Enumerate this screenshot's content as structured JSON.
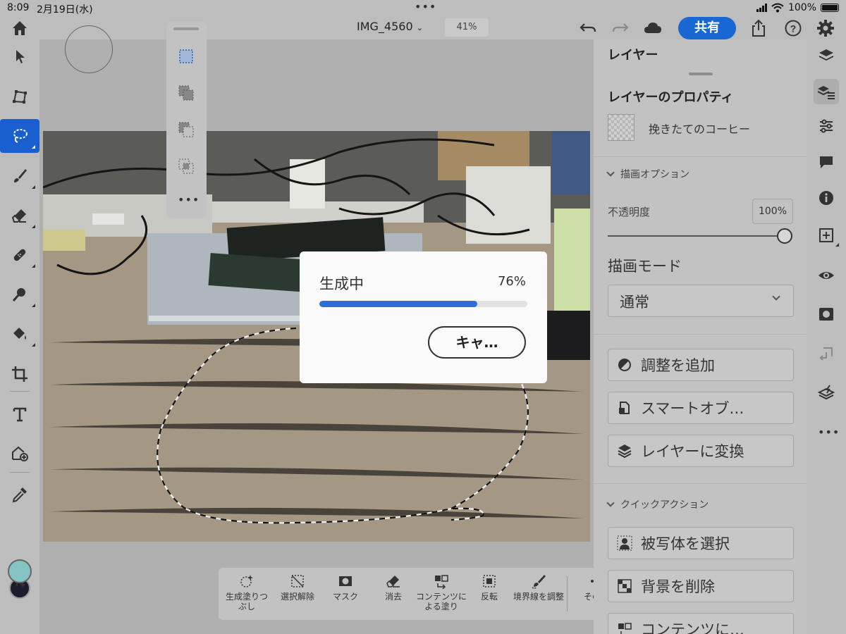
{
  "status_bar": {
    "time": "8:09",
    "date": "2月19日(水)",
    "battery": "100%"
  },
  "topbar": {
    "document_title": "IMG_4560",
    "zoom": "41%",
    "share_label": "共有"
  },
  "left_tools": [
    {
      "name": "select-tool",
      "icon": "arrow-icon"
    },
    {
      "name": "transform-tool",
      "icon": "transform-icon"
    },
    {
      "name": "lasso-tool",
      "icon": "lasso-icon",
      "active": true
    },
    {
      "name": "brush-tool",
      "icon": "brush-icon"
    },
    {
      "name": "eraser-tool",
      "icon": "eraser-icon"
    },
    {
      "name": "heal-tool",
      "icon": "bandage-icon"
    },
    {
      "name": "dodge-burn-tool",
      "icon": "dodge-icon"
    },
    {
      "name": "fill-tool",
      "icon": "paint-bucket-icon"
    },
    {
      "name": "crop-tool",
      "icon": "crop-icon"
    },
    {
      "name": "type-tool",
      "icon": "text-icon"
    },
    {
      "name": "place-image-tool",
      "icon": "place-image-icon"
    },
    {
      "name": "eyedropper-tool",
      "icon": "eyedropper-icon"
    }
  ],
  "colors": {
    "foreground": "#86c3c4",
    "background": "#1c1c2c",
    "accent": "#1967d2"
  },
  "progress_dialog": {
    "label": "生成中",
    "percent_text": "76%",
    "progress": 0.76,
    "cancel_label": "キャ…"
  },
  "context_bar": {
    "items": [
      {
        "label": "生成塗りつぶし",
        "icon": "generative-fill-icon"
      },
      {
        "label": "選択解除",
        "icon": "deselect-icon"
      },
      {
        "label": "マスク",
        "icon": "mask-icon"
      },
      {
        "label": "消去",
        "icon": "eraser-icon"
      },
      {
        "label": "コンテンツによる塗り",
        "icon": "content-aware-fill-icon"
      },
      {
        "label": "反転",
        "icon": "invert-icon"
      },
      {
        "label": "境界線を調整",
        "icon": "refine-edge-icon"
      },
      {
        "label": "その他",
        "icon": "more-icon"
      }
    ]
  },
  "panel": {
    "header": "レイヤー",
    "properties_title": "レイヤーのプロパティ",
    "layer_name": "挽きたてのコーヒー",
    "draw_options_title": "描画オプション",
    "opacity_label": "不透明度",
    "opacity_value": "100%",
    "opacity": 1.0,
    "blend_mode_label": "描画モード",
    "blend_mode_value": "通常",
    "actions": [
      {
        "label": "調整を追加",
        "icon": "adjustment-icon"
      },
      {
        "label": "スマートオブ…",
        "icon": "smart-object-icon"
      },
      {
        "label": "レイヤーに変換",
        "icon": "layers-icon"
      }
    ],
    "quick_actions_title": "クイックアクション",
    "quick_actions": [
      {
        "label": "被写体を選択",
        "icon": "select-subject-icon"
      },
      {
        "label": "背景を削除",
        "icon": "remove-background-icon"
      },
      {
        "label": "コンテンツに…",
        "icon": "content-aware-icon"
      }
    ]
  }
}
